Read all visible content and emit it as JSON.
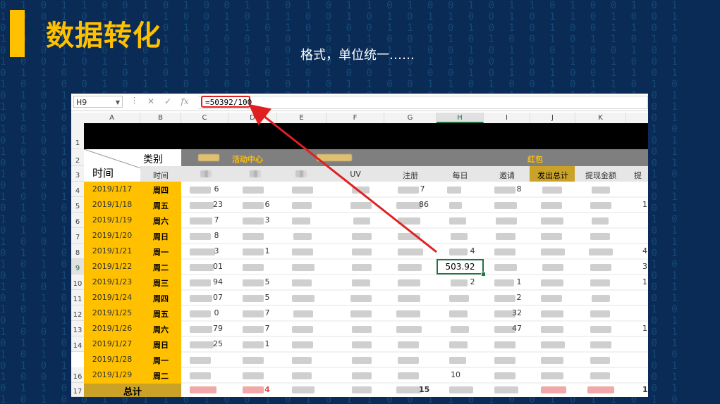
{
  "slide": {
    "title": "数据转化",
    "subtitle": "格式，单位统一……",
    "accent_color": "#ffc000",
    "background_color": "#0a2b55"
  },
  "excel": {
    "name_box": "H9",
    "formula": "=50392/100",
    "formula_buttons": {
      "cancel": "✕",
      "enter": "✓",
      "function": "fx"
    },
    "columns": [
      "A",
      "B",
      "C",
      "D",
      "E",
      "F",
      "G",
      "H",
      "I",
      "J",
      "K"
    ],
    "selected_column": "H",
    "rows": [
      "1",
      "2",
      "3",
      "4",
      "5",
      "6",
      "7",
      "8",
      "9",
      "10",
      "11",
      "12",
      "13",
      "14",
      "16",
      "17"
    ],
    "selected_row": "9",
    "header": {
      "category_label": "类别",
      "time_label": "时间",
      "sub_time": "时间",
      "group_c": "活动中心",
      "group_g": "红包",
      "col_f": "UV",
      "col_g": "注册",
      "col_h": "每日",
      "col_i": "邀请",
      "col_j": "发出总计",
      "col_k": "提现金额",
      "col_l": "提"
    },
    "data_rows": [
      {
        "date": "2019/1/17",
        "weekday": "周四"
      },
      {
        "date": "2019/1/18",
        "weekday": "周五"
      },
      {
        "date": "2019/1/19",
        "weekday": "周六"
      },
      {
        "date": "2019/1/20",
        "weekday": "周日"
      },
      {
        "date": "2019/1/21",
        "weekday": "周一"
      },
      {
        "date": "2019/1/22",
        "weekday": "周二"
      },
      {
        "date": "2019/1/23",
        "weekday": "周三"
      },
      {
        "date": "2019/1/24",
        "weekday": "周四"
      },
      {
        "date": "2019/1/25",
        "weekday": "周五"
      },
      {
        "date": "2019/1/26",
        "weekday": "周六"
      },
      {
        "date": "2019/1/27",
        "weekday": "周日"
      },
      {
        "date": "2019/1/28",
        "weekday": "周一"
      },
      {
        "date": "2019/1/29",
        "weekday": "周二"
      }
    ],
    "selected_cell_value": "503.92",
    "total_label": "总计",
    "partial_values": {
      "c4": "6",
      "c5": "23",
      "c6": "7",
      "c7": "8",
      "c8": "3",
      "c9": "01",
      "c10": "94",
      "c11": "07",
      "c12": "0",
      "c13": "79",
      "c14": "25",
      "d5": "6",
      "d6": "3",
      "d8": "1",
      "d10": "5",
      "d11": "5",
      "d12": "7",
      "d13": "7",
      "d14": "1",
      "d17": "4",
      "g4": "7",
      "g5": "86",
      "g17": "15",
      "h8": "4",
      "h10": "2",
      "h16": "10",
      "i4": "8",
      "i10": "1",
      "i11": "2",
      "i12": "32",
      "i13": "47",
      "l5": "1",
      "l8": "4",
      "l9": "3",
      "l10": "1",
      "l13": "1",
      "l17": "1"
    }
  }
}
